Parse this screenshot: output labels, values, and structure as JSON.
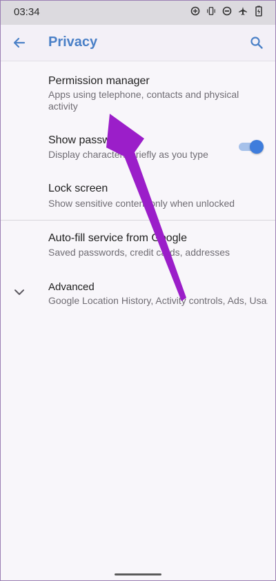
{
  "status_bar": {
    "time": "03:34",
    "icons": [
      "data-saver-icon",
      "vibrate-icon",
      "do-not-disturb-icon",
      "airplane-icon",
      "battery-charging-icon"
    ]
  },
  "toolbar": {
    "title": "Privacy",
    "back_icon": "arrow-left-icon",
    "search_icon": "search-icon"
  },
  "settings": [
    {
      "title": "Permission manager",
      "summary": "Apps using telephone, contacts and physical activity"
    },
    {
      "title": "Show passwords",
      "summary": "Display characters briefly as you type",
      "toggle_on": true
    },
    {
      "title": "Lock screen",
      "summary": "Show sensitive content only when unlocked"
    },
    {
      "title": "Auto-fill service from Google",
      "summary": "Saved passwords, credit cards, addresses"
    },
    {
      "title": "Advanced",
      "summary": "Google Location History, Activity controls, Ads, Usa..",
      "expand_icon": "chevron-down-icon"
    }
  ],
  "colors": {
    "accent": "#4a80c7",
    "toggle_thumb": "#3f7ddc",
    "annotation_arrow": "#9b1ec9"
  }
}
